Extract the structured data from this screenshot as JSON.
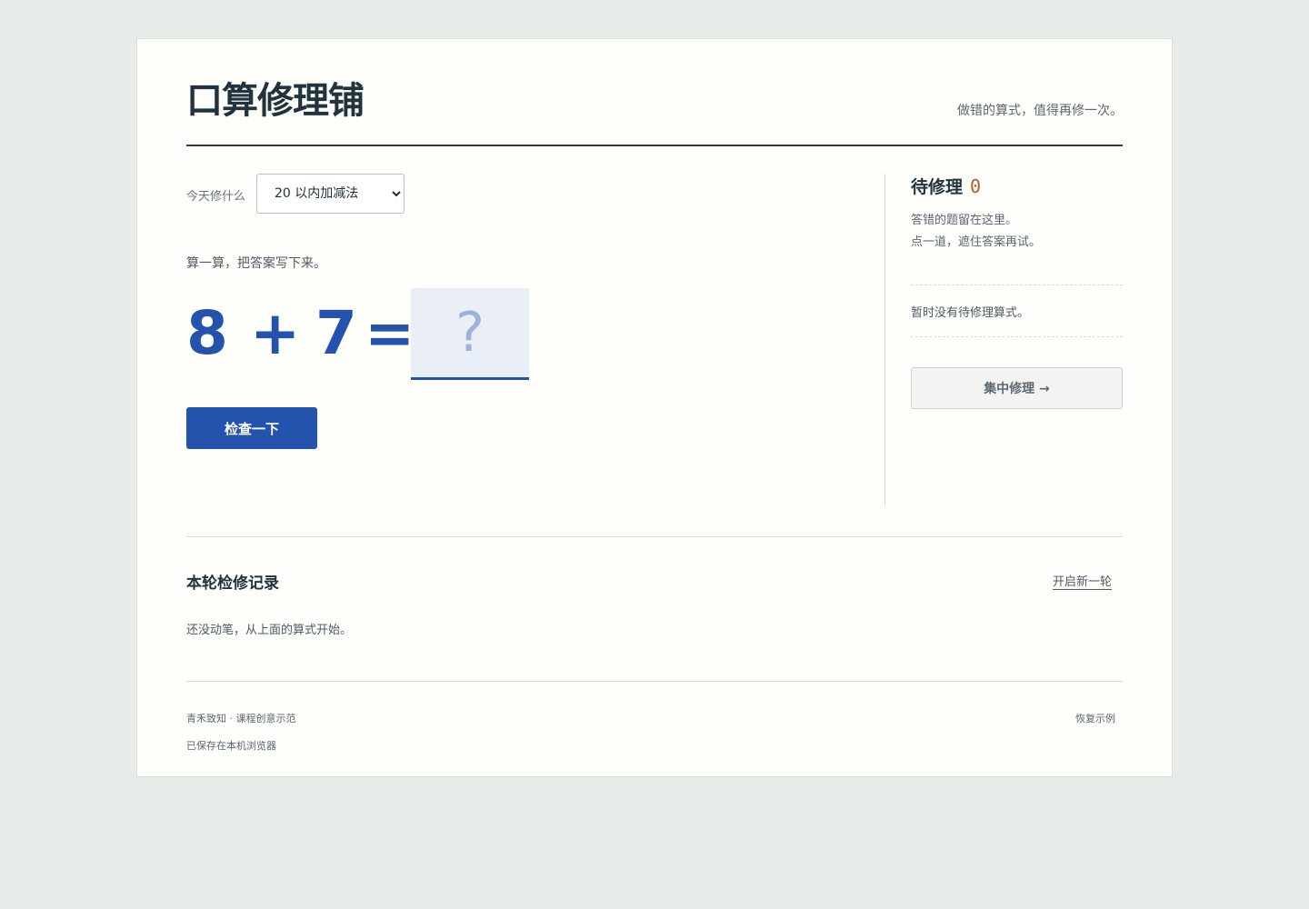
{
  "header": {
    "title": "口算修理铺",
    "tagline": "做错的算式，值得再修一次。"
  },
  "practice": {
    "mode_label": "今天修什么",
    "mode_options": [
      "20 以内加减法"
    ],
    "mode_selected": "20 以内加减法",
    "prompt": "算一算，把答案写下来。",
    "equation": {
      "operand_a": "8",
      "operator": "+",
      "operand_b": "7",
      "equals": "="
    },
    "answer_placeholder": "?",
    "answer_value": "",
    "check_label": "检查一下"
  },
  "repair_queue": {
    "title": "待修理",
    "count": "0",
    "desc_line1": "答错的题留在这里。",
    "desc_line2": "点一道，遮住答案再试。",
    "empty_note": "暂时没有待修理算式。",
    "repair_button": "集中修理 →"
  },
  "log": {
    "title": "本轮检修记录",
    "new_round": "开启新一轮",
    "empty": "还没动笔，从上面的算式开始。"
  },
  "footer": {
    "credit": "青禾致知 · 课程创意示范",
    "saved": "已保存在本机浏览器",
    "restore": "恢复示例"
  },
  "colors": {
    "accent": "#2453ad",
    "count": "#b25a2c",
    "background": "#e8ece9",
    "card": "#fefefa"
  }
}
